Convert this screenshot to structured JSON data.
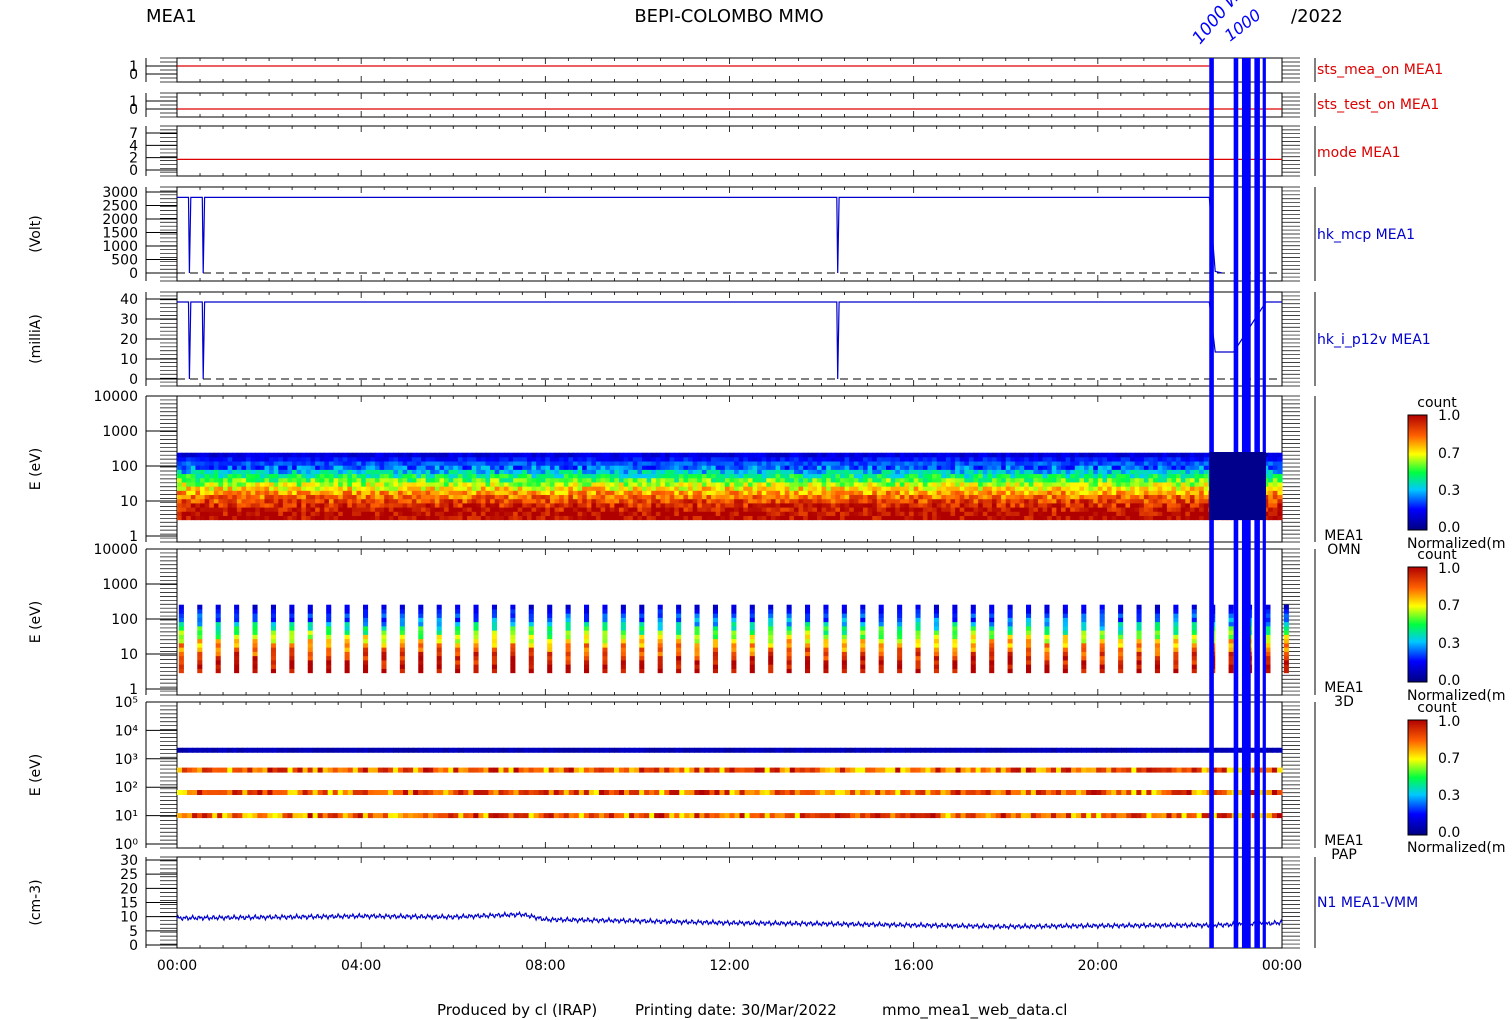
{
  "header": {
    "left": "MEA1",
    "center": "BEPI-COLOMBO MMO",
    "right": "/2022"
  },
  "footer": {
    "produced_by": "Produced by cl (IRAP)",
    "printing_date": "Printing date: 30/Mar/2022",
    "script_name": "mmo_mea1_web_data.cl"
  },
  "colors": {
    "red_trace": "#dd0000",
    "blue_trace": "#0000cc",
    "gap_blue": "#0000ff",
    "axis": "#000000"
  },
  "colorbar": {
    "title": "count",
    "ticks": [
      "1.0",
      "0.7",
      "0.3",
      "0.0"
    ],
    "label": "Normalized(m"
  },
  "chart_data": {
    "type": "multi-panel time series",
    "x_ticks": [
      "00:00",
      "04:00",
      "08:00",
      "12:00",
      "16:00",
      "20:00",
      "00:00"
    ],
    "x_range_hours": [
      0,
      24
    ],
    "gap_hours": [
      [
        22.42,
        22.52
      ],
      [
        22.95,
        23.05
      ],
      [
        23.13,
        23.32
      ],
      [
        23.4,
        23.52
      ],
      [
        23.58,
        23.65
      ]
    ],
    "panels": [
      {
        "id": "sts_mea_on",
        "type": "line",
        "label": "sts_mea_on MEA1",
        "ylabel": "",
        "yticks": [
          "1",
          "0"
        ],
        "ylim": [
          0,
          1
        ],
        "color": "red",
        "points": [
          [
            0,
            1
          ],
          [
            22.42,
            1
          ]
        ]
      },
      {
        "id": "sts_test_on",
        "type": "line",
        "label": "sts_test_on MEA1",
        "ylabel": "",
        "yticks": [
          "1",
          "0"
        ],
        "ylim": [
          0,
          1
        ],
        "color": "red",
        "points": [
          [
            0,
            0
          ],
          [
            24,
            0
          ]
        ]
      },
      {
        "id": "mode",
        "type": "line",
        "label": "mode MEA1",
        "ylabel": "",
        "yticks": [
          "7",
          "4",
          "2",
          "0"
        ],
        "ylim": [
          0,
          7
        ],
        "color": "red",
        "points": [
          [
            0,
            2
          ],
          [
            24,
            2
          ]
        ]
      },
      {
        "id": "hk_mcp",
        "type": "line",
        "label": "hk_mcp MEA1",
        "ylabel": "(Volt)",
        "yticks": [
          "3000",
          "2500",
          "2000",
          "1500",
          "1000",
          "500",
          "0"
        ],
        "ylim": [
          0,
          3000
        ],
        "color": "blue",
        "points": [
          [
            0,
            2800
          ],
          [
            0.25,
            2800
          ],
          [
            0.27,
            0
          ],
          [
            0.3,
            2800
          ],
          [
            0.55,
            2800
          ],
          [
            0.57,
            0
          ],
          [
            0.6,
            2800
          ],
          [
            14.33,
            2800
          ],
          [
            14.35,
            0
          ],
          [
            14.38,
            2800
          ],
          [
            22.42,
            2800
          ],
          [
            22.55,
            60
          ],
          [
            22.7,
            0
          ]
        ]
      },
      {
        "id": "hk_i_p12v",
        "type": "line",
        "label": "hk_i_p12v MEA1",
        "ylabel": "(milliA)",
        "yticks": [
          "40",
          "30",
          "20",
          "10",
          "0"
        ],
        "ylim": [
          0,
          40
        ],
        "color": "blue",
        "points": [
          [
            0,
            38.5
          ],
          [
            0.25,
            38.5
          ],
          [
            0.27,
            0
          ],
          [
            0.3,
            38.5
          ],
          [
            0.55,
            38.5
          ],
          [
            0.57,
            0
          ],
          [
            0.6,
            38.5
          ],
          [
            14.33,
            38.5
          ],
          [
            14.35,
            0
          ],
          [
            14.38,
            38.5
          ],
          [
            22.42,
            38.5
          ],
          [
            22.55,
            13.5
          ],
          [
            22.95,
            13.5
          ],
          [
            23.65,
            38.5
          ],
          [
            24,
            38.5
          ]
        ]
      },
      {
        "id": "omn",
        "type": "heatmap",
        "label": "MEA1",
        "sublabel": "OMN",
        "ylabel": "E (eV)",
        "yticks": [
          "10000",
          "1000",
          "100",
          "10",
          "1"
        ],
        "ylim": [
          1,
          13000
        ],
        "energy_range_eV": [
          3,
          280
        ],
        "colorscale": "count, Normalized"
      },
      {
        "id": "3d",
        "type": "heatmap",
        "label": "MEA1",
        "sublabel": "3D",
        "ylabel": "E (eV)",
        "yticks": [
          "10000",
          "1000",
          "100",
          "10",
          "1"
        ],
        "ylim": [
          1,
          13000
        ],
        "energy_range_eV": [
          3,
          300
        ],
        "colorscale": "count, Normalized"
      },
      {
        "id": "pap",
        "type": "heatmap",
        "label": "MEA1",
        "sublabel": "PAP",
        "ylabel": "E (eV)",
        "yticks": [
          "10⁵",
          "10⁴",
          "10³",
          "10²",
          "10¹",
          "10⁰"
        ],
        "ylim": [
          1,
          100000
        ],
        "energy_bands_eV": [
          2000,
          400,
          65,
          10
        ],
        "colorscale": "count, Normalized"
      },
      {
        "id": "n1",
        "type": "line",
        "label": "N1 MEA1-VMM",
        "ylabel": "(cm-3)",
        "yticks": [
          "30",
          "25",
          "20",
          "15",
          "10",
          "5",
          "0"
        ],
        "ylim": [
          0,
          30
        ],
        "color": "blue",
        "points": [
          [
            0,
            9.5
          ],
          [
            2,
            9.8
          ],
          [
            4,
            10.2
          ],
          [
            6,
            9.9
          ],
          [
            7.5,
            10.8
          ],
          [
            8,
            9.0
          ],
          [
            10,
            8.5
          ],
          [
            12,
            7.8
          ],
          [
            14,
            7.5
          ],
          [
            16,
            7.0
          ],
          [
            18,
            6.5
          ],
          [
            20,
            6.8
          ],
          [
            22.42,
            7.0
          ],
          [
            23.7,
            7.5
          ],
          [
            24,
            8.0
          ]
        ]
      }
    ]
  }
}
